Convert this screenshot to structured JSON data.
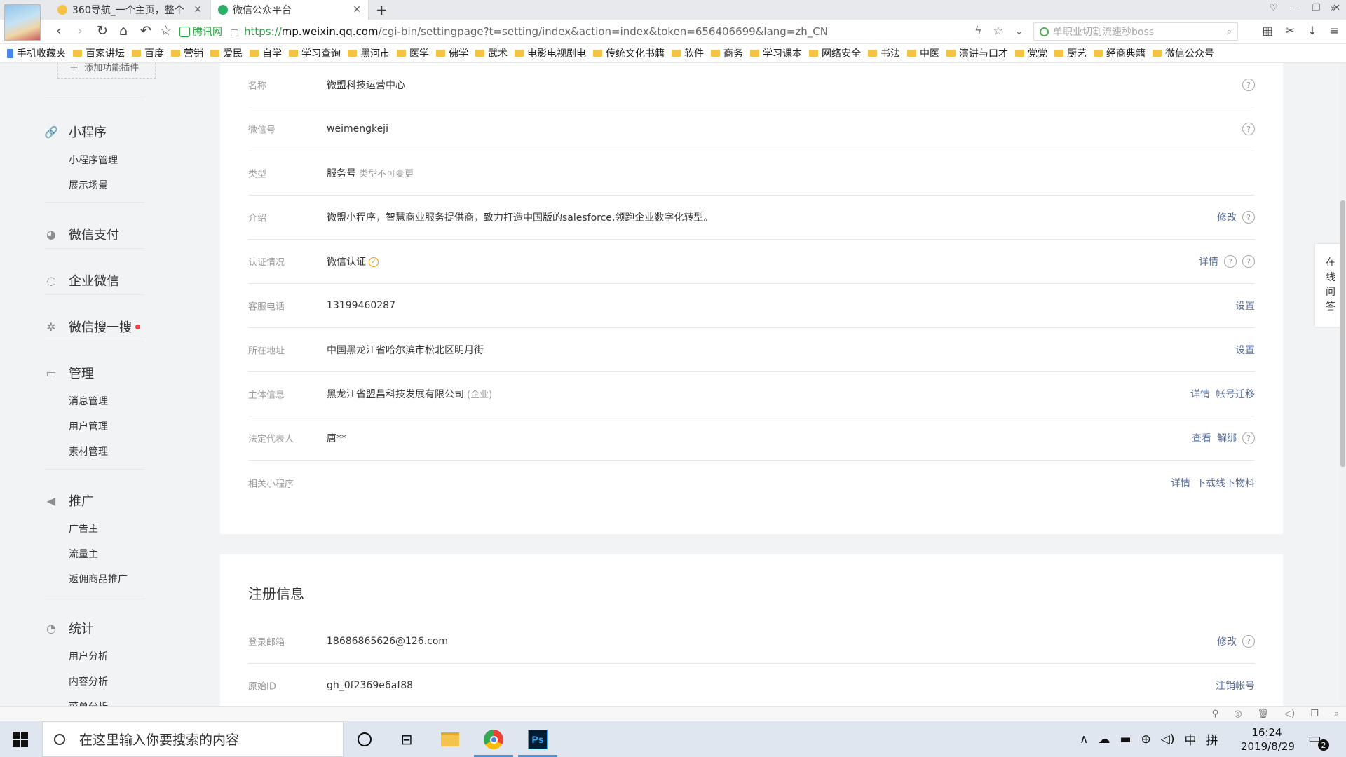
{
  "browser": {
    "tabs": [
      {
        "title": "360导航_一个主页，整个",
        "favicon_color": "#f5c242"
      },
      {
        "title": "微信公众平台",
        "favicon_color": "#2aae67"
      }
    ],
    "secure_label": "腾讯网",
    "url_https": "https://",
    "url_host": "mp.weixin.qq.com",
    "url_path": "/cgi-bin/settingpage?t=setting/index&action=index&token=656406699&lang=zh_CN",
    "search_placeholder": "单职业切割流速秒boss",
    "bookmarks": [
      "手机收藏夹",
      "百家讲坛",
      "百度",
      "营销",
      "爱民",
      "自学",
      "学习查询",
      "黑河市",
      "医学",
      "佛学",
      "武术",
      "电影电视剧电",
      "传统文化书籍",
      "软件",
      "商务",
      "学习课本",
      "网络安全",
      "书法",
      "中医",
      "演讲与口才",
      "党党",
      "厨艺",
      "经商典籍",
      "微信公众号"
    ]
  },
  "sidebar": {
    "add_plugin": "添加功能插件",
    "groups": [
      {
        "icon": "link-icon",
        "glyph": "🔗",
        "label": "小程序",
        "items": [
          "小程序管理",
          "展示场景"
        ]
      },
      {
        "icon": "wechat-pay-icon",
        "glyph": "◕",
        "label": "微信支付",
        "items": []
      },
      {
        "icon": "work-wechat-icon",
        "glyph": "◌",
        "label": "企业微信",
        "items": []
      },
      {
        "icon": "search-spark-icon",
        "glyph": "✲",
        "label": "微信搜一搜",
        "items": [],
        "dot": true
      },
      {
        "icon": "inbox-icon",
        "glyph": "▭",
        "label": "管理",
        "items": [
          "消息管理",
          "用户管理",
          "素材管理"
        ]
      },
      {
        "icon": "megaphone-icon",
        "glyph": "◀",
        "label": "推广",
        "items": [
          "广告主",
          "流量主",
          "返佣商品推广"
        ]
      },
      {
        "icon": "pie-chart-icon",
        "glyph": "◔",
        "label": "统计",
        "items": [
          "用户分析",
          "内容分析",
          "菜单分析"
        ]
      }
    ]
  },
  "account_info": {
    "rows": [
      {
        "label": "名称",
        "value": "微盟科技运营中心",
        "note": "",
        "actions": [],
        "help": true
      },
      {
        "label": "微信号",
        "value": "weimengkeji",
        "note": "",
        "actions": [],
        "help": true
      },
      {
        "label": "类型",
        "value": "服务号",
        "note": "类型不可变更",
        "actions": [],
        "help": false
      },
      {
        "label": "介绍",
        "value": "微盟小程序，智慧商业服务提供商，致力打造中国版的salesforce,领跑企业数字化转型。",
        "note": "",
        "actions": [
          "修改"
        ],
        "help": true
      },
      {
        "label": "认证情况",
        "value": "微信认证",
        "note": "",
        "verified": true,
        "actions": [
          "详情"
        ],
        "help": true,
        "help_double": true
      },
      {
        "label": "客服电话",
        "value": "13199460287",
        "note": "",
        "actions": [
          "设置"
        ],
        "help": false
      },
      {
        "label": "所在地址",
        "value": "中国黑龙江省哈尔滨市松北区明月街",
        "note": "",
        "actions": [
          "设置"
        ],
        "help": false
      },
      {
        "label": "主体信息",
        "value": "黑龙江省盟昌科技发展有限公司",
        "note": "(企业)",
        "actions": [
          "详情",
          "帐号迁移"
        ],
        "help": false
      },
      {
        "label": "法定代表人",
        "value": "唐**",
        "note": "",
        "actions": [
          "查看",
          "解绑"
        ],
        "help": true
      },
      {
        "label": "相关小程序",
        "value": "",
        "note": "",
        "actions": [
          "详情",
          "下载线下物料"
        ],
        "help": false
      }
    ]
  },
  "registration": {
    "title": "注册信息",
    "rows": [
      {
        "label": "登录邮箱",
        "value": "18686865626@126.com",
        "actions": [
          "修改"
        ],
        "help": true
      },
      {
        "label": "原始ID",
        "value": "gh_0f2369e6af88",
        "actions": [
          "注销帐号"
        ],
        "help": false
      }
    ]
  },
  "online_help": [
    "在",
    "线",
    "问",
    "答"
  ],
  "taskbar": {
    "search_placeholder": "在这里输入你要搜索的内容",
    "ime_lang": "中",
    "ime_mode": "拼",
    "time": "16:24",
    "date": "2019/8/29",
    "notification_count": "2"
  },
  "colors": {
    "link": "#576b95",
    "verified": "#f39c12",
    "secure": "#2ea043",
    "red_dot": "#e64340"
  }
}
